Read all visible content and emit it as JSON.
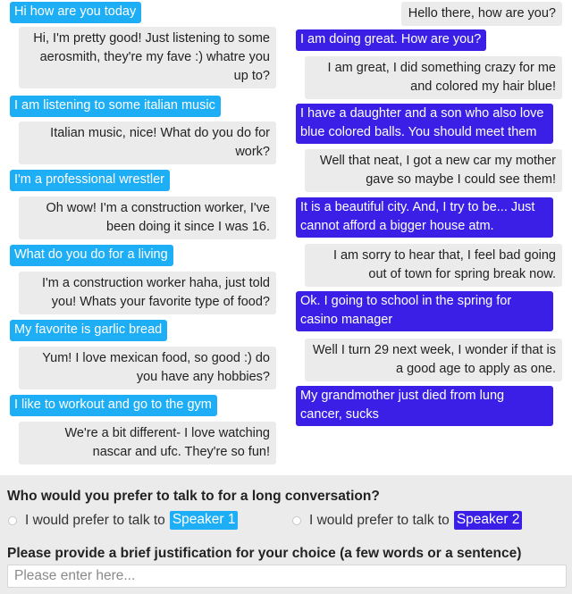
{
  "speaker1_color": "#1eaef5",
  "speaker2_color": "#3b1fe6",
  "left_conversation": [
    {
      "role": "speaker",
      "text": "Hi how are you today"
    },
    {
      "role": "partner",
      "text": "Hi, I'm pretty good! Just listening to some aerosmith, they're my fave :) whatre you up to?"
    },
    {
      "role": "speaker",
      "text": "I am listening to some italian music"
    },
    {
      "role": "partner",
      "text": "Italian music, nice! What do you do for work?"
    },
    {
      "role": "speaker",
      "text": "I'm a professional wrestler"
    },
    {
      "role": "partner",
      "text": "Oh wow! I'm a construction worker, I've been doing it since I was 16."
    },
    {
      "role": "speaker",
      "text": "What do you do for a living"
    },
    {
      "role": "partner",
      "text": "I'm a construction worker haha, just told you! Whats your favorite type of food?"
    },
    {
      "role": "speaker",
      "text": "My favorite is garlic bread"
    },
    {
      "role": "partner",
      "text": "Yum! I love mexican food, so good :) do you have any hobbies?"
    },
    {
      "role": "speaker",
      "text": "I like to workout and go to the gym"
    },
    {
      "role": "partner",
      "text": "We're a bit different- I love watching nascar and ufc. They're so fun!"
    }
  ],
  "right_conversation": [
    {
      "role": "partner",
      "text": "Hello there, how are you?"
    },
    {
      "role": "speaker",
      "text": "I am doing great. How are you?"
    },
    {
      "role": "partner",
      "text": "I am great, I did something crazy for me and colored my hair blue!"
    },
    {
      "role": "speaker",
      "text": "I have a daughter and a son who also love blue colored balls. You should meet them"
    },
    {
      "role": "partner",
      "text": "Well that neat, I got a new car my mother gave so maybe I could see them!"
    },
    {
      "role": "speaker",
      "text": "It is a beautiful city. And, I try to be... Just cannot afford a bigger house atm."
    },
    {
      "role": "partner",
      "text": "I am sorry to hear that, I feel bad going out of town for spring break now."
    },
    {
      "role": "speaker",
      "text": "Ok. I going to school in the spring for casino manager"
    },
    {
      "role": "partner",
      "text": "Well I turn 29 next week, I wonder if that is a good age to apply as one."
    },
    {
      "role": "speaker",
      "text": "My grandmother just died from lung cancer, sucks"
    }
  ],
  "form": {
    "question": "Who would you prefer to talk to for a long conversation?",
    "options": [
      {
        "prefix": "I would prefer to talk to",
        "speaker": "Speaker 1",
        "selected": false
      },
      {
        "prefix": "I would prefer to talk to",
        "speaker": "Speaker 2",
        "selected": false
      }
    ],
    "justification_label": "Please provide a brief justification for your choice (a few words or a sentence)",
    "justification_value": "",
    "justification_placeholder": "Please enter here..."
  }
}
